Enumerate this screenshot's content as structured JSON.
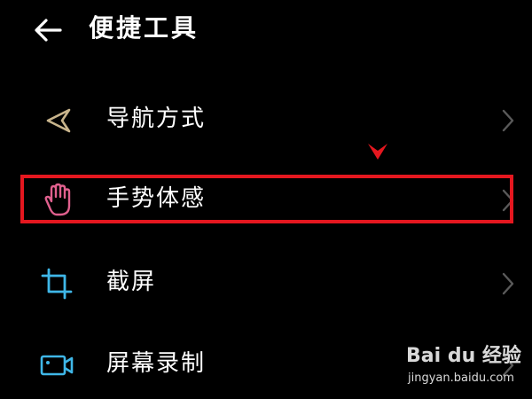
{
  "header": {
    "title": "便捷工具",
    "back_icon": "back-arrow-icon"
  },
  "items": [
    {
      "label": "导航方式",
      "icon": "navigation-icon",
      "icon_color": "#c8b48c",
      "highlighted": false
    },
    {
      "label": "手势体感",
      "icon": "hand-gesture-icon",
      "icon_color": "#e0608e",
      "highlighted": true
    },
    {
      "label": "截屏",
      "icon": "screenshot-crop-icon",
      "icon_color": "#3fb7e8",
      "highlighted": false
    },
    {
      "label": "屏幕录制",
      "icon": "screen-record-icon",
      "icon_color": "#3fb7e8",
      "highlighted": false
    }
  ],
  "annotation": {
    "box_color": "#e5171f",
    "arrow_color": "#e5171f"
  },
  "watermark": {
    "logo": "Bai du 经验",
    "url": "jingyan.baidu.com"
  }
}
